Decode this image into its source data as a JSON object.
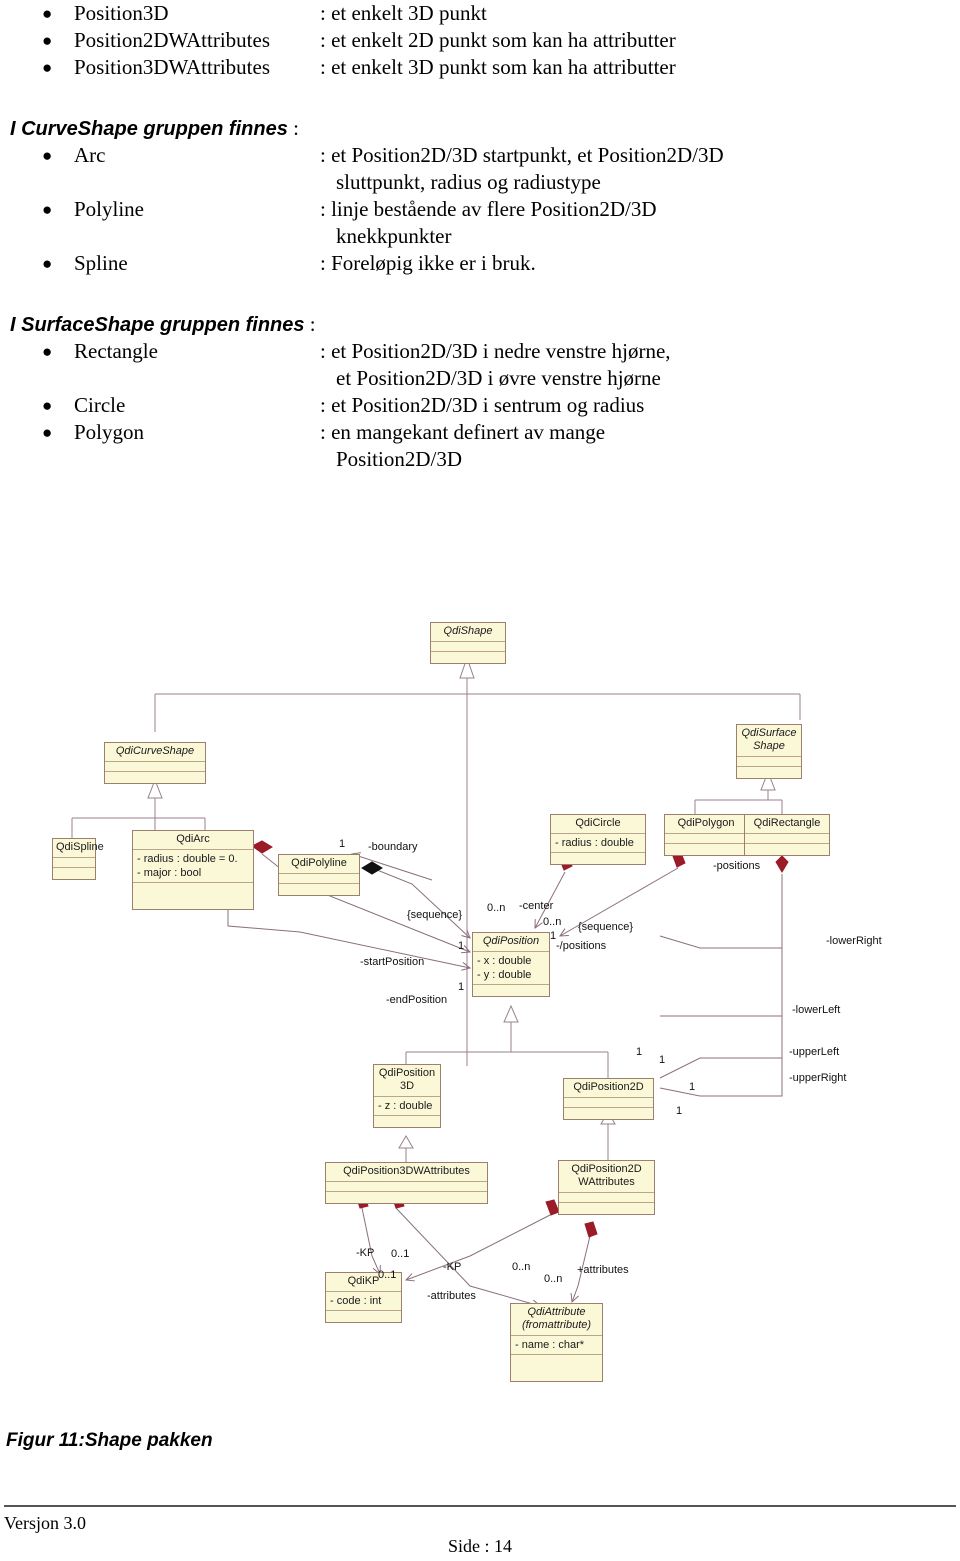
{
  "document": {
    "intro_bullets": [
      {
        "term": "Position3D",
        "desc": ": et enkelt 3D punkt",
        "cont": ""
      },
      {
        "term": "Position2DWAttributes",
        "desc": ": et enkelt 2D punkt som kan ha attributter",
        "cont": ""
      },
      {
        "term": "Position3DWAttributes",
        "desc": ": et enkelt 3D punkt som kan ha attributter",
        "cont": ""
      }
    ],
    "curve_group": {
      "heading_italic": "I CurveShape gruppen finnes",
      "heading_colon": " :",
      "bullets": [
        {
          "term": "Arc",
          "desc": ": et Position2D/3D startpunkt, et Position2D/3D",
          "cont": "sluttpunkt, radius og radiustype"
        },
        {
          "term": "Polyline",
          "desc": ": linje bestående av flere Position2D/3D",
          "cont": "knekkpunkter"
        },
        {
          "term": "Spline",
          "desc": ": Foreløpig ikke er i bruk.",
          "cont": ""
        }
      ]
    },
    "surface_group": {
      "heading_italic": "I SurfaceShape gruppen finnes",
      "heading_colon": " :",
      "bullets": [
        {
          "term": "Rectangle",
          "desc": ": et Position2D/3D i nedre venstre hjørne,",
          "cont": "et Position2D/3D i øvre venstre hjørne"
        },
        {
          "term": "Circle",
          "desc": ": et Position2D/3D i sentrum og radius",
          "cont": ""
        },
        {
          "term": "Polygon",
          "desc": ": en mangekant definert av mange",
          "cont": "Position2D/3D"
        }
      ]
    },
    "figure_caption": "Figur 11:Shape pakken",
    "footer": {
      "left": "Versjon 3.0",
      "center": "Side : 14"
    }
  },
  "diagram": {
    "colors": {
      "box_fill": "#fbf8d8",
      "box_border": "#9c7f6e",
      "compartment_rule": "#b9a68d",
      "edge": "#8a6f7c",
      "generalization": "#9a8088",
      "aggregation_filled": "#9c1b28",
      "composition_black": "#111111"
    },
    "classes": [
      {
        "id": "QdiShape",
        "name": "QdiShape",
        "abstract": true,
        "attrs": []
      },
      {
        "id": "QdiCurveShape",
        "name": "QdiCurveShape",
        "abstract": true,
        "attrs": []
      },
      {
        "id": "QdiSurfaceShape",
        "name": "QdiSurface\nShape",
        "abstract": true,
        "attrs": []
      },
      {
        "id": "QdiSpline",
        "name": "QdiSpline",
        "abstract": false,
        "attrs": []
      },
      {
        "id": "QdiArc",
        "name": "QdiArc",
        "abstract": false,
        "attrs": [
          "- radius : double = 0.",
          "- major : bool"
        ]
      },
      {
        "id": "QdiPolyline",
        "name": "QdiPolyline",
        "abstract": false,
        "attrs": []
      },
      {
        "id": "QdiCircle",
        "name": "QdiCircle",
        "abstract": false,
        "attrs": [
          "- radius : double"
        ]
      },
      {
        "id": "QdiPolygon",
        "name": "QdiPolygon",
        "abstract": false,
        "attrs": []
      },
      {
        "id": "QdiRectangle",
        "name": "QdiRectangle",
        "abstract": false,
        "attrs": []
      },
      {
        "id": "QdiPosition",
        "name": "QdiPosition",
        "abstract": true,
        "attrs": [
          "- x : double",
          "- y : double"
        ]
      },
      {
        "id": "QdiPosition3D",
        "name": "QdiPosition\n3D",
        "abstract": false,
        "attrs": [
          "- z : double"
        ]
      },
      {
        "id": "QdiPosition2D",
        "name": "QdiPosition2D",
        "abstract": false,
        "attrs": []
      },
      {
        "id": "QdiPosition3DWAttributes",
        "name": "QdiPosition3DWAttributes",
        "abstract": false,
        "attrs": []
      },
      {
        "id": "QdiPosition2DWAttributes",
        "name": "QdiPosition2D\nWAttributes",
        "abstract": false,
        "attrs": []
      },
      {
        "id": "QdiKP",
        "name": "QdiKP",
        "abstract": false,
        "attrs": [
          "- code : int"
        ]
      },
      {
        "id": "QdiAttribute",
        "name": "QdiAttribute\n(fromattribute)",
        "abstract": true,
        "attrs": [
          "- name : char*"
        ]
      }
    ],
    "labels": {
      "boundary": "-boundary",
      "positions_polygon": "-positions",
      "sequence_left": "{sequence}",
      "sequence_right": "{sequence}",
      "start_position": "-startPosition",
      "end_position": "-endPosition",
      "center": "-center",
      "derived_positions": "-/positions",
      "lower_right": "-lowerRight",
      "lower_left": "-lowerLeft",
      "upper_left": "-upperLeft",
      "upper_right": "-upperRight",
      "kp_left": "-KP",
      "kp_right": "-KP",
      "attributes_left": "-attributes",
      "attributes_right": "+attributes"
    },
    "multiplicities": {
      "polyline_boundary": "1",
      "polyline_positions": "0..n",
      "arc_start": "1",
      "arc_end": "1",
      "circle_center": "0..n",
      "polygon_positions": "1",
      "pos2d_a": "1",
      "pos2d_b": "1",
      "pos2d_c": "1",
      "pos2d_d": "1",
      "kp_a": "0..1",
      "kp_b": "0..1",
      "attr_a": "0..n",
      "attr_b": "0..n"
    }
  }
}
